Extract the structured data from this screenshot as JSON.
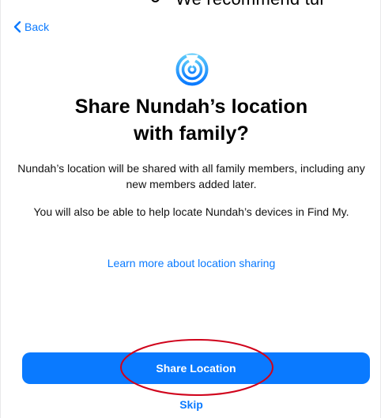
{
  "overlay_text": "We recommend tur",
  "nav": {
    "back_label": "Back"
  },
  "header": {
    "icon": "location-sharing-icon",
    "title_line1": "Share Nundah’s location",
    "title_line2": "with family?"
  },
  "content": {
    "paragraph1": "Nundah’s location will be shared with all family members, including any new members added later.",
    "paragraph2": "You will also be able to help locate Nundah’s devices in Find My.",
    "learn_more_link": "Learn more about location sharing"
  },
  "actions": {
    "primary_label": "Share Location",
    "secondary_label": "Skip"
  },
  "colors": {
    "accent": "#0a7aff",
    "annotation": "#d0021b",
    "background": "#ffffff"
  }
}
